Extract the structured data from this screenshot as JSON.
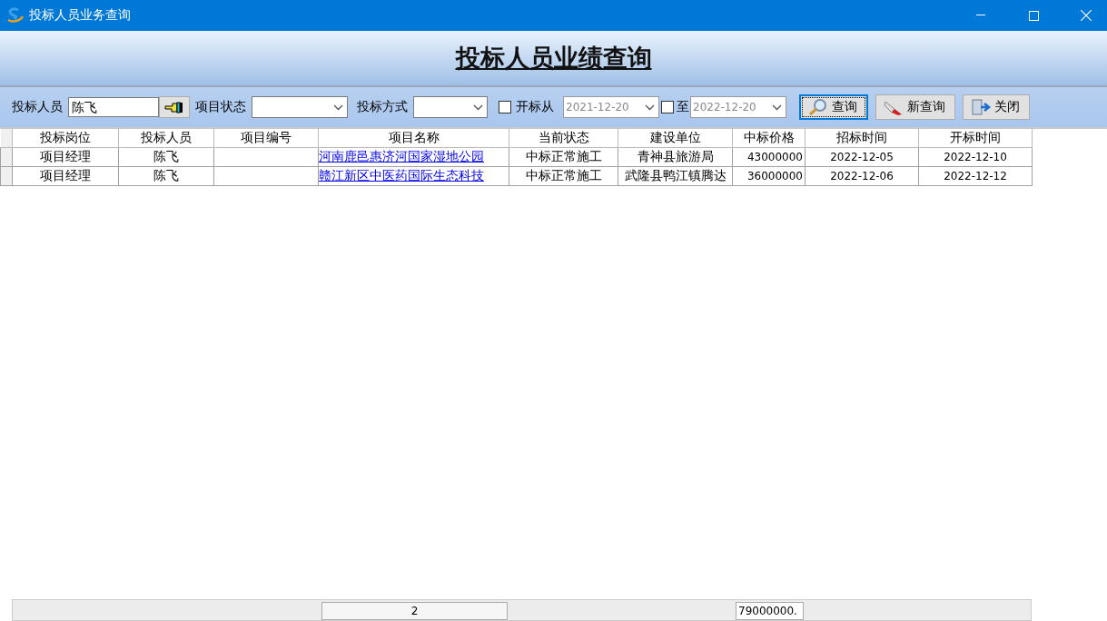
{
  "window": {
    "title": "投标人员业务查询"
  },
  "heading": "投标人员业绩查询",
  "filters": {
    "person_label": "投标人员",
    "person_value": "陈飞",
    "status_label": "项目状态",
    "method_label": "投标方式",
    "open_from": {
      "label": "开标从",
      "checked": false,
      "date": "2021-12-20"
    },
    "open_to": {
      "label": "至",
      "checked": false,
      "date": "2022-12-20"
    }
  },
  "buttons": [
    {
      "kind": "search",
      "label": "查询",
      "focused": true
    },
    {
      "kind": "new",
      "label": "新查询",
      "focused": false
    },
    {
      "kind": "close",
      "label": "关闭",
      "focused": false
    }
  ],
  "table": {
    "columns": [
      "投标岗位",
      "投标人员",
      "项目编号",
      "项目名称",
      "当前状态",
      "建设单位",
      "中标价格",
      "招标时间",
      "开标时间"
    ],
    "rows": [
      {
        "cells": [
          "项目经理",
          "陈飞",
          "",
          "河南鹿邑惠济河国家湿地公园",
          "中标正常施工",
          "青神县旅游局",
          "43000000",
          "2022-12-05",
          "2022-12-10"
        ]
      },
      {
        "cells": [
          "项目经理",
          "陈飞",
          "",
          "赣江新区中医药国际生态科技",
          "中标正常施工",
          "武隆县鸭江镇腾达",
          "36000000",
          "2022-12-06",
          "2022-12-12"
        ]
      }
    ]
  },
  "summary": {
    "count": "2",
    "total": "79000000."
  }
}
